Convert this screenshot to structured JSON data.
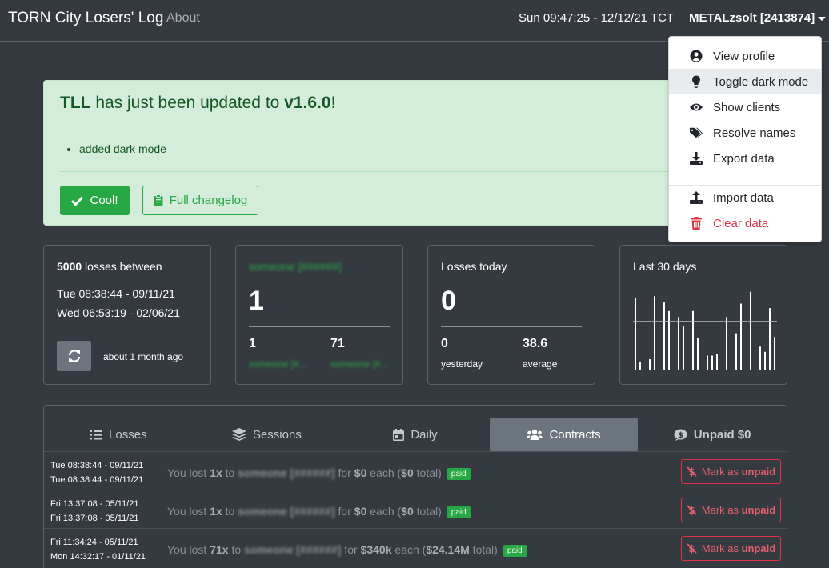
{
  "navbar": {
    "brand": "TORN City Losers' Log",
    "about": "About",
    "clock": "Sun 09:47:25 - 12/12/21 TCT",
    "user": "METALzsolt [2413874]"
  },
  "alert": {
    "title_app": "TLL",
    "title_text": " has just been updated to ",
    "title_version": "v1.6.0",
    "title_end": "!",
    "changes": [
      "added dark mode"
    ],
    "cool_label": "Cool!",
    "changelog_label": "Full changelog"
  },
  "cards": {
    "range": {
      "count": "5000",
      "title_suffix": " losses between",
      "from": "Tue 08:38:44 - 09/11/21",
      "to": "Wed 06:53:19 - 02/06/21",
      "ago": "about 1 month ago"
    },
    "top": {
      "name": "someone [######]",
      "value": "1",
      "left_value": "1",
      "left_label": "someone [#...",
      "right_value": "71",
      "right_label": "someone [#..."
    },
    "today": {
      "title": "Losses today",
      "value": "0",
      "left_value": "0",
      "left_label": "yesterday",
      "right_value": "38.6",
      "right_label": "average"
    },
    "last30": {
      "title": "Last 30 days"
    }
  },
  "chart_data": {
    "type": "bar",
    "title": "Last 30 days",
    "values": [
      98,
      12,
      0,
      15,
      100,
      0,
      92,
      80,
      0,
      72,
      60,
      0,
      80,
      44,
      0,
      20,
      20,
      22,
      0,
      72,
      0,
      50,
      90,
      0,
      106,
      0,
      32,
      25,
      84,
      45
    ],
    "average": 66,
    "ylim": [
      0,
      110
    ]
  },
  "tabs": [
    {
      "label": "Losses",
      "icon": "list-icon",
      "active": false
    },
    {
      "label": "Sessions",
      "icon": "layers-icon",
      "active": false
    },
    {
      "label": "Daily",
      "icon": "calendar-icon",
      "active": false
    },
    {
      "label": "Contracts",
      "icon": "users-icon",
      "active": true
    },
    {
      "label": "Unpaid $0",
      "icon": "dollar-icon",
      "active": false
    }
  ],
  "rows": [
    {
      "date1": "Tue 08:38:44 - 09/11/21",
      "date2": "Tue 08:38:44 - 09/11/21",
      "prefix": "You lost ",
      "qty": "1x",
      "to": " to ",
      "target": "someone [######]",
      "for": " for ",
      "price": "$0",
      "each": " each (",
      "total": "$0",
      "tot_suffix": " total)",
      "status": "paid",
      "action": "Mark as ",
      "action_b": "unpaid"
    },
    {
      "date1": "Fri 13:37:08 - 05/11/21",
      "date2": "Fri 13:37:08 - 05/11/21",
      "prefix": "You lost ",
      "qty": "1x",
      "to": " to ",
      "target": "someone [######]",
      "for": " for ",
      "price": "$0",
      "each": " each (",
      "total": "$0",
      "tot_suffix": " total)",
      "status": "paid",
      "action": "Mark as ",
      "action_b": "unpaid"
    },
    {
      "date1": "Fri 11:34:24 - 05/11/21",
      "date2": "Mon 14:32:17 - 01/11/21",
      "prefix": "You lost ",
      "qty": "71x",
      "to": " to ",
      "target": "someone [######]",
      "for": " for ",
      "price": "$340k",
      "each": " each (",
      "total": "$24.14M",
      "tot_suffix": " total)",
      "status": "paid",
      "action": "Mark as ",
      "action_b": "unpaid"
    }
  ],
  "dropdown": [
    {
      "label": "View profile",
      "icon": "user-circle-icon"
    },
    {
      "label": "Toggle dark mode",
      "icon": "lightbulb-icon"
    },
    {
      "label": "Show clients",
      "icon": "eye-icon"
    },
    {
      "label": "Resolve names",
      "icon": "tags-icon"
    },
    {
      "label": "Export data",
      "icon": "download-icon"
    },
    {
      "label": "Import data",
      "icon": "upload-icon"
    },
    {
      "label": "Clear data",
      "icon": "trash-icon"
    }
  ],
  "colors": {
    "background": "#343a40",
    "success": "#28a745",
    "danger": "#dc3545",
    "alert_bg": "#d4edda"
  }
}
